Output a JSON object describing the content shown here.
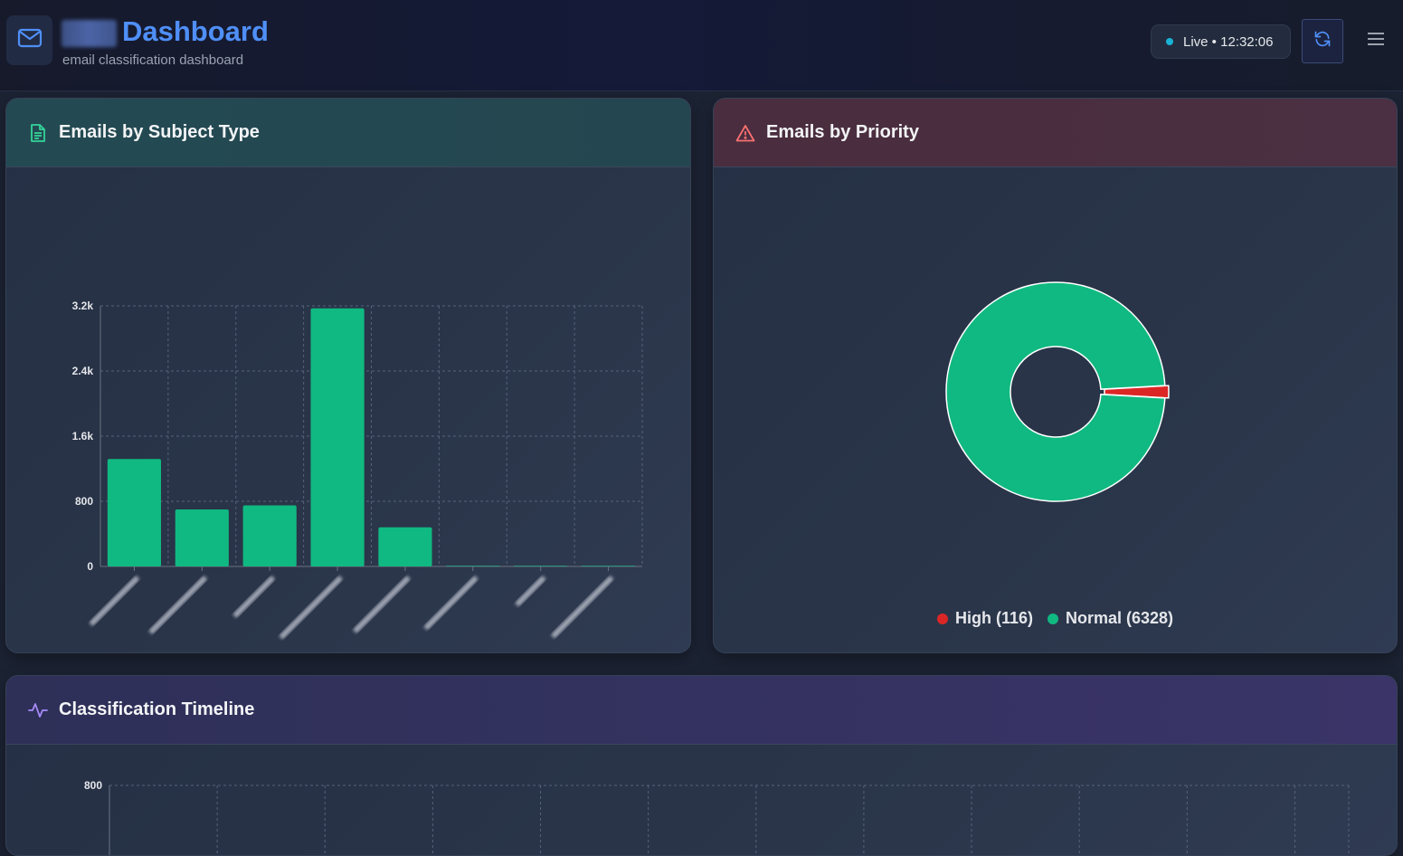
{
  "header": {
    "title": "Dashboard",
    "subtitle": "email classification dashboard",
    "live_status": "Live • 12:32:06",
    "icons": {
      "logo": "mail-icon",
      "refresh": "refresh-icon",
      "menu": "hamburger-menu-icon"
    }
  },
  "cards": {
    "subject": {
      "title": "Emails by Subject Type",
      "icon": "document-icon"
    },
    "priority": {
      "title": "Emails by Priority",
      "icon": "warning-triangle-icon"
    },
    "timeline": {
      "title": "Classification Timeline",
      "icon": "activity-icon"
    }
  },
  "colors": {
    "accent": "#4f8ff7",
    "green": "#10b981",
    "red": "#dc2626"
  },
  "chart_data": [
    {
      "type": "bar",
      "categories": [
        "",
        "",
        "",
        "",
        "",
        "",
        "",
        ""
      ],
      "values": [
        1320,
        700,
        750,
        3170,
        480,
        0,
        0,
        0
      ],
      "ylim": [
        0,
        3200
      ],
      "yticks": [
        "0",
        "800",
        "1.6k",
        "2.4k",
        "3.2k"
      ],
      "grid": true
    },
    {
      "type": "pie",
      "labels": [
        "High",
        "Normal"
      ],
      "values": [
        116,
        6328
      ],
      "legend": [
        "High (116)",
        "Normal (6328)"
      ],
      "legend_position": "bottom",
      "colors": [
        "#dc2626",
        "#10b981"
      ],
      "donut": true
    },
    {
      "type": "line",
      "yticks": [
        "800"
      ],
      "grid": true
    }
  ]
}
